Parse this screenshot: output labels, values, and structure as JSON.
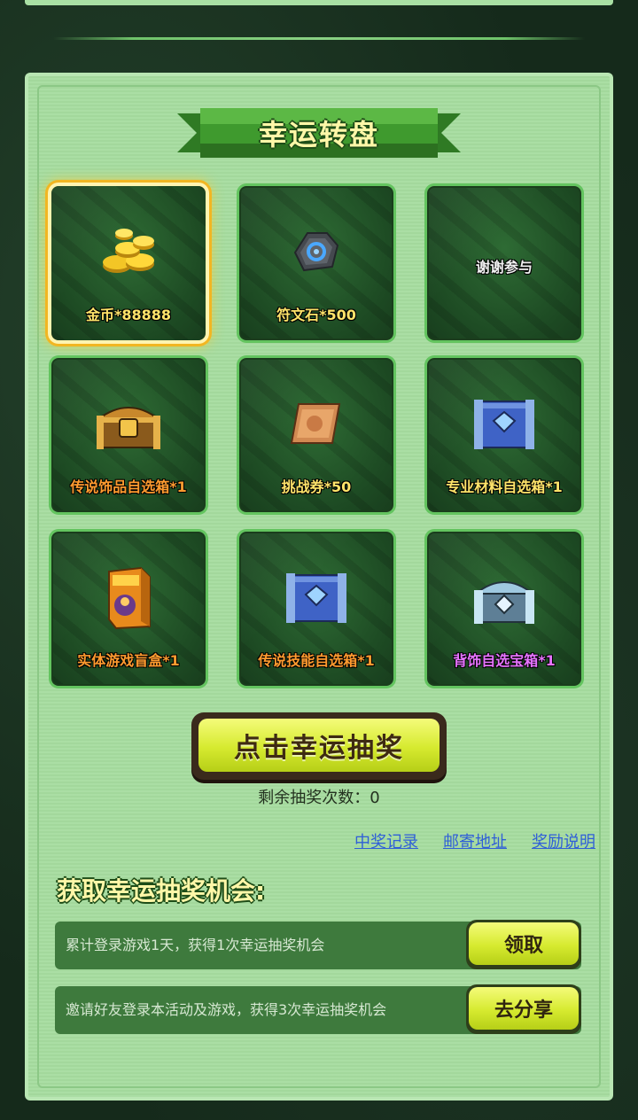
{
  "title": "幸运转盘",
  "prizes": [
    {
      "label": "金币*88888",
      "icon": "gold-coins-icon",
      "color": "yellow",
      "selected": true
    },
    {
      "label": "符文石*500",
      "icon": "rune-stone-icon",
      "color": "yellow",
      "selected": false
    },
    {
      "label": "谢谢参与",
      "icon": "",
      "color": "white",
      "selected": false
    },
    {
      "label": "传说饰品自选箱*1",
      "icon": "legendary-chest-icon",
      "color": "orange",
      "selected": false
    },
    {
      "label": "挑战券*50",
      "icon": "challenge-ticket-icon",
      "color": "yellow",
      "selected": false
    },
    {
      "label": "专业材料自选箱*1",
      "icon": "blue-chest-icon",
      "color": "yellow",
      "selected": false
    },
    {
      "label": "实体游戏盲盒*1",
      "icon": "blind-box-icon",
      "color": "orange",
      "selected": false
    },
    {
      "label": "传说技能自选箱*1",
      "icon": "blue-chest-icon",
      "color": "orange",
      "selected": false
    },
    {
      "label": "背饰自选宝箱*1",
      "icon": "silver-chest-icon",
      "color": "purple",
      "selected": false
    }
  ],
  "draw_button": "点击幸运抽奖",
  "remaining_text": "剩余抽奖次数：0",
  "links": [
    "中奖记录",
    "邮寄地址",
    "奖励说明"
  ],
  "section_title": "获取幸运抽奖机会:",
  "tasks": [
    {
      "text": "累计登录游戏1天，获得1次幸运抽奖机会",
      "button": "领取"
    },
    {
      "text": "邀请好友登录本活动及游戏，获得3次幸运抽奖机会",
      "button": "去分享"
    }
  ]
}
